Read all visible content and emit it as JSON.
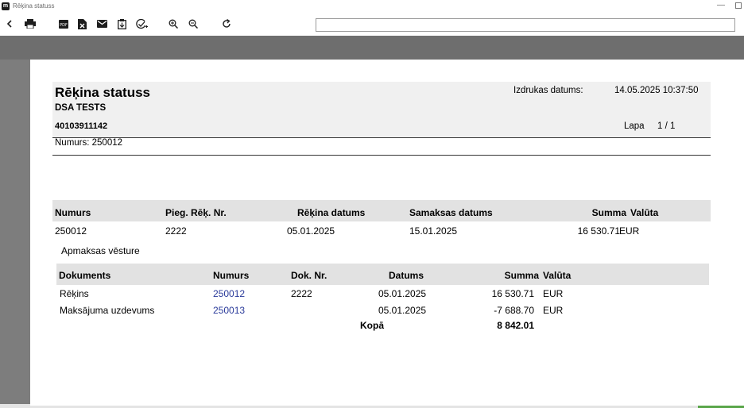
{
  "window": {
    "title": "Rēķina statuss",
    "icon_letter": "m"
  },
  "toolbar": {
    "url_value": "",
    "buttons": [
      "back-icon",
      "print-icon",
      "pdf-icon",
      "excel-icon",
      "mail-icon",
      "clipboard-icon",
      "approve-icon",
      "zoom-in-icon",
      "zoom-out-icon",
      "refresh-icon"
    ],
    "pdf_label": "PDF"
  },
  "report": {
    "title": "Rēķina statuss",
    "company": "DSA TESTS",
    "reg_no": "40103911142",
    "print_date_label": "Izdrukas datums:",
    "print_date_value": "14.05.2025 10:37:50",
    "page_label": "Lapa",
    "page_value": "1 / 1",
    "number_line": "Numurs: 250012"
  },
  "main_table": {
    "headers": {
      "number": "Numurs",
      "supplier_invoice_no": "Pieg. Rēķ. Nr.",
      "invoice_date": "Rēķina datums",
      "due_date": "Samaksas datums",
      "amount": "Summa",
      "currency": "Valūta"
    },
    "rows": [
      {
        "number": "250012",
        "supplier_invoice_no": "2222",
        "invoice_date": "05.01.2025",
        "due_date": "15.01.2025",
        "amount": "16 530.71",
        "currency": "EUR"
      }
    ]
  },
  "payment_history": {
    "title": "Apmaksas vēsture",
    "headers": {
      "document": "Dokuments",
      "number": "Numurs",
      "doc_no": "Dok. Nr.",
      "date": "Datums",
      "amount": "Summa",
      "currency": "Valūta"
    },
    "rows": [
      {
        "document": "Rēķins",
        "number": "250012",
        "doc_no": "2222",
        "date": "05.01.2025",
        "amount": "16 530.71",
        "currency": "EUR"
      },
      {
        "document": "Maksājuma uzdevums",
        "number": "250013",
        "doc_no": "",
        "date": "05.01.2025",
        "amount": "-7 688.70",
        "currency": "EUR"
      }
    ],
    "total_label": "Kopā",
    "total_value": "8 842.01"
  },
  "colors": {
    "link": "#2a3a9a",
    "viewer_bg": "#7d7d7d",
    "header_band": "#e2e2e2"
  }
}
